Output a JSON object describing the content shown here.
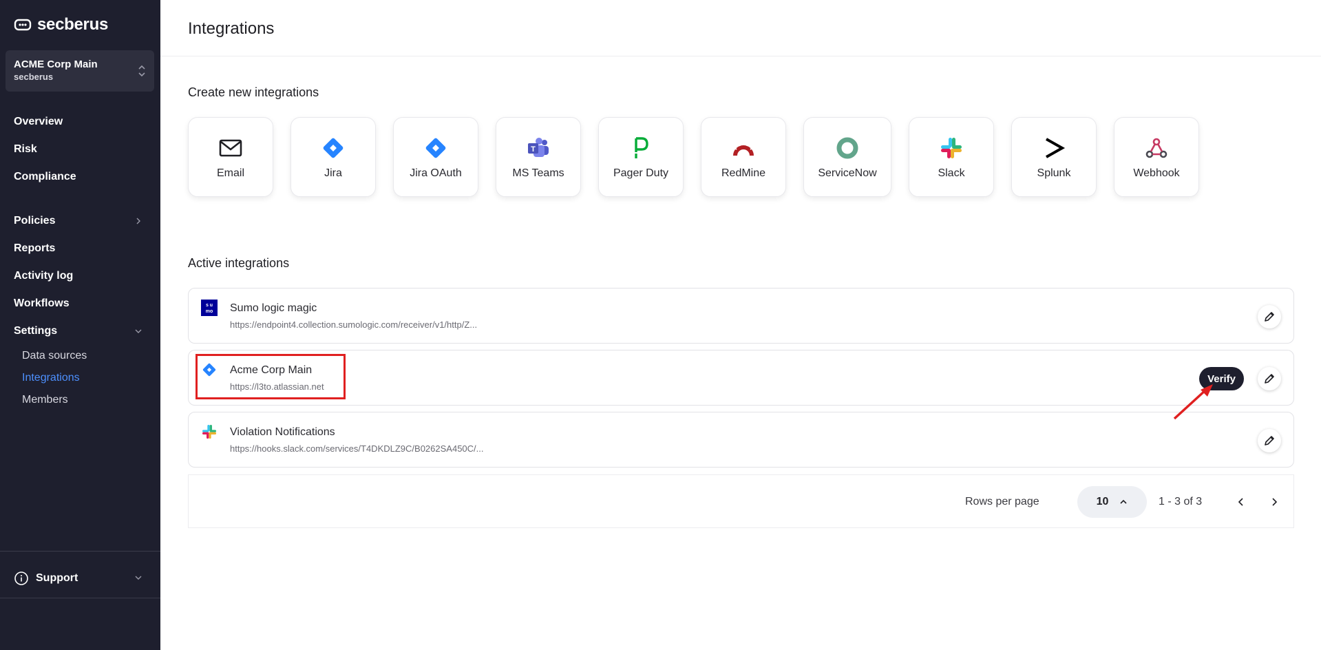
{
  "brand": {
    "name": "secberus"
  },
  "org": {
    "name": "ACME Corp Main",
    "sub": "secberus"
  },
  "nav": {
    "overview": "Overview",
    "risk": "Risk",
    "compliance": "Compliance",
    "policies": "Policies",
    "reports": "Reports",
    "activity_log": "Activity log",
    "workflows": "Workflows",
    "settings": "Settings",
    "sub": [
      "Data sources",
      "Integrations",
      "Members"
    ]
  },
  "support": "Support",
  "page": {
    "title": "Integrations"
  },
  "create": {
    "title": "Create new integrations",
    "tiles": [
      {
        "label": "Email",
        "icon": "email-icon"
      },
      {
        "label": "Jira",
        "icon": "jira-icon"
      },
      {
        "label": "Jira OAuth",
        "icon": "jira-icon"
      },
      {
        "label": "MS Teams",
        "icon": "ms-teams-icon"
      },
      {
        "label": "Pager Duty",
        "icon": "pagerduty-icon"
      },
      {
        "label": "RedMine",
        "icon": "redmine-icon"
      },
      {
        "label": "ServiceNow",
        "icon": "servicenow-icon"
      },
      {
        "label": "Slack",
        "icon": "slack-icon"
      },
      {
        "label": "Splunk",
        "icon": "splunk-icon"
      },
      {
        "label": "Webhook",
        "icon": "webhook-icon"
      }
    ]
  },
  "active": {
    "title": "Active integrations",
    "items": [
      {
        "name": "Sumo logic magic",
        "url": "https://endpoint4.collection.sumologic.com/receiver/v1/http/Z...",
        "icon": "sumo-logic-icon"
      },
      {
        "name": "Acme Corp Main",
        "url": "https://l3to.atlassian.net",
        "icon": "jira-icon",
        "verify": "Verify"
      },
      {
        "name": "Violation Notifications",
        "url": "https://hooks.slack.com/services/T4DKDLZ9C/B0262SA450C/...",
        "icon": "slack-icon"
      }
    ]
  },
  "pagination": {
    "rows_label": "Rows per page",
    "rows_value": "10",
    "range": "1 - 3 of 3"
  },
  "colors": {
    "sidebar": "#1e1f2e",
    "active_link": "#4d90fe",
    "annotation": "#e02020"
  }
}
